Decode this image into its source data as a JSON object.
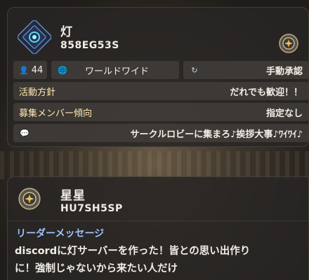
{
  "circle1": {
    "name": "灯",
    "code": "858EG53S",
    "members": "44",
    "region": "ワールドワイド",
    "approval": "手動承認",
    "policy_label": "活動方針",
    "policy_value": "だれでも歓迎！！",
    "tendency_label": "募集メンバー傾向",
    "tendency_value": "指定なし",
    "comment": "サークルロビーに集まろ♪挨拶大事♪ﾜｲﾜｲ♪"
  },
  "circle2": {
    "name": "星星",
    "code": "HU7SH5SP",
    "message_title": "リーダーメッセージ",
    "message_line1": "discordに灯サーバーを作った！皆との思い出作り",
    "message_line2": "に！強制じゃないから来たい人だけ"
  },
  "colors": {
    "accent_cyan": "#5fd6e6",
    "message_title": "#9fc2ff",
    "label_gold": "#ffe8b0"
  },
  "icons": [
    "circle-emblem-icon",
    "gear-emblem-icon",
    "member-icon",
    "globe-icon",
    "approval-icon",
    "chat-icon"
  ]
}
